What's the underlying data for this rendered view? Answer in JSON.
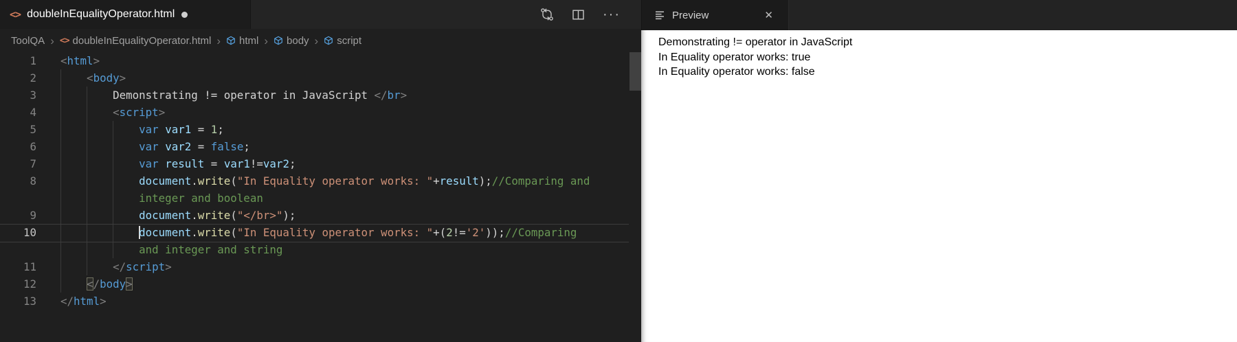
{
  "editor": {
    "tab": {
      "filename": "doubleInEqualityOperator.html",
      "modified": true
    },
    "toolbar": {
      "open_changes": "open-changes",
      "split_editor": "split-editor",
      "more_actions": "···"
    },
    "breadcrumb": {
      "separator": "›",
      "items": [
        {
          "label": "ToolQA",
          "icon": ""
        },
        {
          "label": "doubleInEqualityOperator.html",
          "icon": "code"
        },
        {
          "label": "html",
          "icon": "cube"
        },
        {
          "label": "body",
          "icon": "cube"
        },
        {
          "label": "script",
          "icon": "cube"
        }
      ]
    },
    "rows": [
      {
        "n": "1",
        "t": [
          [
            "p",
            "<"
          ],
          [
            "tag",
            "html"
          ],
          [
            "p",
            ">"
          ]
        ]
      },
      {
        "n": "2",
        "t": [
          [
            "ws",
            "    "
          ],
          [
            "p",
            "<"
          ],
          [
            "tag",
            "body"
          ],
          [
            "p",
            ">"
          ]
        ]
      },
      {
        "n": "3",
        "t": [
          [
            "ws",
            "        "
          ],
          [
            "txt",
            "Demonstrating != operator in JavaScript "
          ],
          [
            "p",
            "</"
          ],
          [
            "tag",
            "br"
          ],
          [
            "p",
            ">"
          ]
        ]
      },
      {
        "n": "4",
        "t": [
          [
            "ws",
            "        "
          ],
          [
            "p",
            "<"
          ],
          [
            "tag",
            "script"
          ],
          [
            "p",
            ">"
          ]
        ]
      },
      {
        "n": "5",
        "t": [
          [
            "ws",
            "            "
          ],
          [
            "kw",
            "var"
          ],
          [
            "op",
            " "
          ],
          [
            "var",
            "var1"
          ],
          [
            "op",
            " = "
          ],
          [
            "num",
            "1"
          ],
          [
            "op",
            ";"
          ]
        ]
      },
      {
        "n": "6",
        "t": [
          [
            "ws",
            "            "
          ],
          [
            "kw",
            "var"
          ],
          [
            "op",
            " "
          ],
          [
            "var",
            "var2"
          ],
          [
            "op",
            " = "
          ],
          [
            "kw",
            "false"
          ],
          [
            "op",
            ";"
          ]
        ]
      },
      {
        "n": "7",
        "t": [
          [
            "ws",
            "            "
          ],
          [
            "kw",
            "var"
          ],
          [
            "op",
            " "
          ],
          [
            "var",
            "result"
          ],
          [
            "op",
            " = "
          ],
          [
            "var",
            "var1"
          ],
          [
            "op",
            "!="
          ],
          [
            "var",
            "var2"
          ],
          [
            "op",
            ";"
          ]
        ]
      },
      {
        "n": "8",
        "t": [
          [
            "ws",
            "            "
          ],
          [
            "var",
            "document"
          ],
          [
            "op",
            "."
          ],
          [
            "fn",
            "write"
          ],
          [
            "op",
            "("
          ],
          [
            "str",
            "\"In Equality operator works: \""
          ],
          [
            "op",
            "+"
          ],
          [
            "var",
            "result"
          ],
          [
            "op",
            ");"
          ],
          [
            "cmt",
            "//Comparing and"
          ]
        ]
      },
      {
        "n": "",
        "t": [
          [
            "ws",
            "            "
          ],
          [
            "cmt",
            "integer and boolean"
          ]
        ]
      },
      {
        "n": "9",
        "t": [
          [
            "ws",
            "            "
          ],
          [
            "var",
            "document"
          ],
          [
            "op",
            "."
          ],
          [
            "fn",
            "write"
          ],
          [
            "op",
            "("
          ],
          [
            "str",
            "\"</br>\""
          ],
          [
            "op",
            ");"
          ]
        ]
      },
      {
        "n": "10",
        "current": true,
        "t": [
          [
            "ws",
            "            "
          ],
          [
            "cursor",
            ""
          ],
          [
            "var",
            "document"
          ],
          [
            "op",
            "."
          ],
          [
            "fn",
            "write"
          ],
          [
            "op",
            "("
          ],
          [
            "str",
            "\"In Equality operator works: \""
          ],
          [
            "op",
            "+("
          ],
          [
            "num",
            "2"
          ],
          [
            "op",
            "!="
          ],
          [
            "str",
            "'2'"
          ],
          [
            "op",
            "));"
          ],
          [
            "cmt",
            "//Comparing"
          ]
        ]
      },
      {
        "n": "",
        "t": [
          [
            "ws",
            "            "
          ],
          [
            "cmt",
            "and integer and string"
          ]
        ]
      },
      {
        "n": "11",
        "t": [
          [
            "ws",
            "        "
          ],
          [
            "p",
            "</"
          ],
          [
            "tag",
            "script"
          ],
          [
            "p",
            ">"
          ]
        ]
      },
      {
        "n": "12",
        "t": [
          [
            "ws",
            "    "
          ],
          [
            "phl",
            "<"
          ],
          [
            "p",
            "/"
          ],
          [
            "tag",
            "body"
          ],
          [
            "phl",
            ">"
          ]
        ]
      },
      {
        "n": "13",
        "t": [
          [
            "p",
            "</"
          ],
          [
            "tag",
            "html"
          ],
          [
            "p",
            ">"
          ]
        ]
      }
    ]
  },
  "preview": {
    "tab_label": "Preview",
    "close_label": "✕",
    "lines": [
      "Demonstrating != operator in JavaScript",
      "In Equality operator works: true",
      "In Equality operator works: false"
    ]
  },
  "colors": {
    "editor_bg": "#1f1f1f",
    "tabbar_bg": "#242424",
    "tab_active_bg": "#1c1c1c",
    "keyword": "#569cd6",
    "variable": "#9cdcfe",
    "string": "#ce9178",
    "comment": "#6a9955",
    "number": "#b5cea8",
    "function": "#dcdcaa",
    "tag_punctuation": "#808080",
    "plain_text": "#d4d4d4",
    "line_number": "#858585",
    "breadcrumb_text": "#a0a0a0",
    "cube_icon": "#58a6e6",
    "file_icon": "#cf7a5a",
    "preview_bg": "#ffffff",
    "preview_text": "#000000"
  }
}
